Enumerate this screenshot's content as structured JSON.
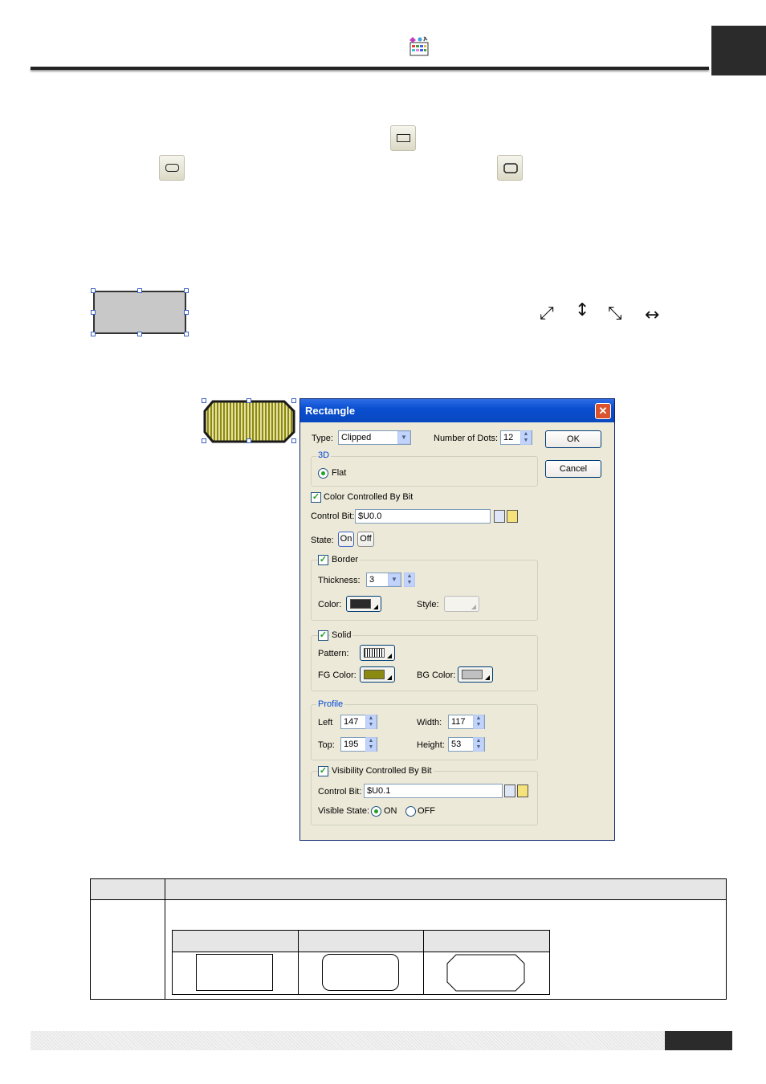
{
  "dialog": {
    "title": "Rectangle",
    "type_label": "Type:",
    "type_value": "Clipped",
    "dots_label": "Number of Dots:",
    "dots_value": "12",
    "ok_label": "OK",
    "cancel_label": "Cancel",
    "group_3d": "3D",
    "flat_label": "Flat",
    "color_by_bit_label": "Color Controlled By Bit",
    "control_bit_label": "Control Bit:",
    "control_bit_value": "$U0.0",
    "state_label": "State:",
    "state_on": "On",
    "state_off": "Off",
    "border_label": "Border",
    "thickness_label": "Thickness:",
    "thickness_value": "3",
    "color_label": "Color:",
    "style_label": "Style:",
    "solid_label": "Solid",
    "pattern_label": "Pattern:",
    "fg_color_label": "FG Color:",
    "bg_color_label": "BG Color:",
    "profile_label": "Profile",
    "left_label": "Left",
    "left_value": "147",
    "width_label": "Width:",
    "width_value": "117",
    "top_label": "Top:",
    "top_value": "195",
    "height_label": "Height:",
    "height_value": "53",
    "visibility_label": "Visibility Controlled By Bit",
    "vis_control_bit_label": "Control Bit:",
    "vis_control_bit_value": "$U0.1",
    "visible_state_label": "Visible State:",
    "vis_on": "ON",
    "vis_off": "OFF",
    "colors": {
      "border_color": "#2a2a2a",
      "fg_color": "#8a8a10",
      "bg_color": "#c0c0c0"
    }
  },
  "icons": [
    "app-toolbox-icon",
    "rectangle-tool-icon",
    "rounded-rectangle-tool-icon",
    "clipped-rectangle-tool-icon",
    "resize-diagonal-ne-icon",
    "resize-vertical-icon",
    "resize-diagonal-nw-icon",
    "resize-horizontal-icon"
  ]
}
